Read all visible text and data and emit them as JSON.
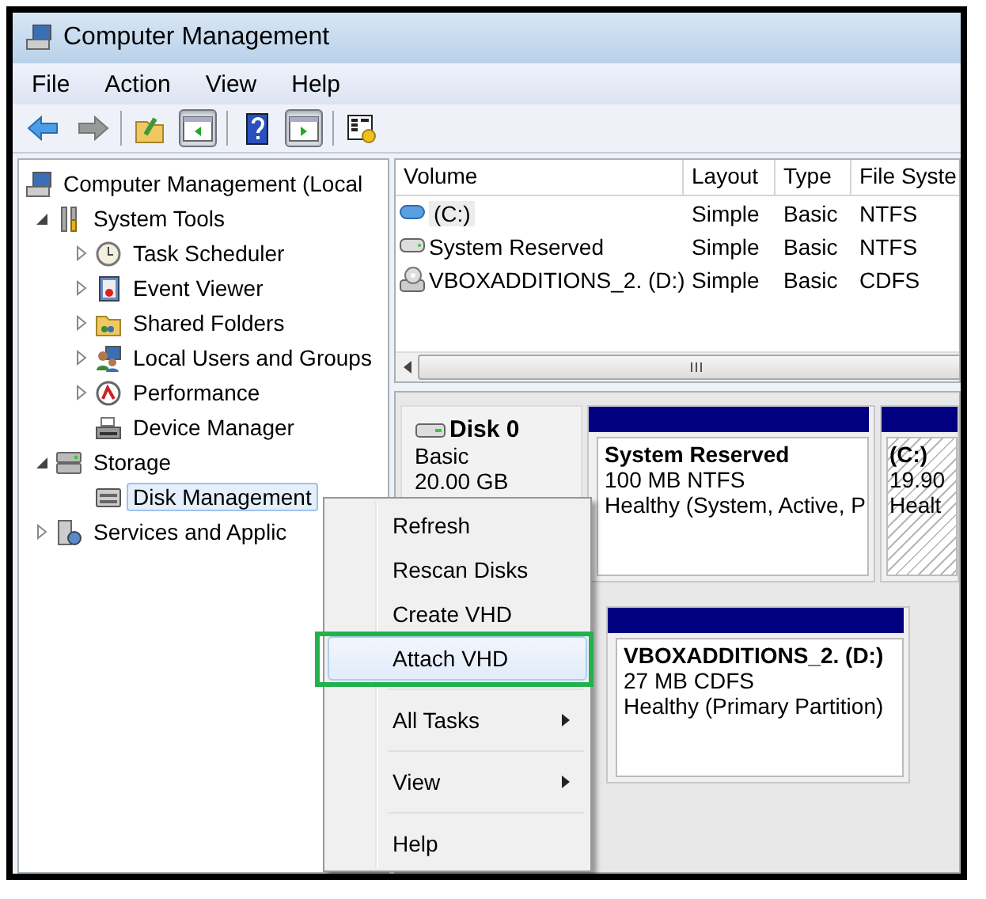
{
  "window": {
    "title": "Computer Management"
  },
  "menu_bar": [
    "File",
    "Action",
    "View",
    "Help"
  ],
  "toolbar": [
    {
      "kind": "back",
      "pressed": false
    },
    {
      "kind": "forward",
      "pressed": false
    },
    {
      "kind": "separator"
    },
    {
      "kind": "up",
      "pressed": false
    },
    {
      "kind": "pane-left",
      "pressed": true
    },
    {
      "kind": "separator"
    },
    {
      "kind": "help",
      "pressed": false
    },
    {
      "kind": "pane-right",
      "pressed": true
    },
    {
      "kind": "separator"
    },
    {
      "kind": "properties",
      "pressed": false
    }
  ],
  "tree": [
    {
      "label": "Computer Management (Local",
      "selected": false,
      "children": [
        {
          "label": "System Tools",
          "expanded": true,
          "selected": false,
          "children": [
            {
              "label": "Task Scheduler",
              "expanded": false,
              "selected": false
            },
            {
              "label": "Event Viewer",
              "expanded": false,
              "selected": false
            },
            {
              "label": "Shared Folders",
              "expanded": false,
              "selected": false
            },
            {
              "label": "Local Users and Groups",
              "expanded": false,
              "selected": false
            },
            {
              "label": "Performance",
              "expanded": false,
              "selected": false
            },
            {
              "label": "Device Manager",
              "selected": false
            }
          ]
        },
        {
          "label": "Storage",
          "expanded": true,
          "selected": false,
          "children": [
            {
              "label": "Disk Management",
              "selected": true
            }
          ]
        },
        {
          "label": "Services and Applic",
          "expanded": false,
          "selected": false
        }
      ]
    }
  ],
  "volume_table": {
    "columns": [
      "Volume",
      "Layout",
      "Type",
      "File Syste"
    ],
    "rows": [
      {
        "selected": true,
        "cells": [
          "(C:)",
          "Simple",
          "Basic",
          "NTFS"
        ]
      },
      {
        "selected": false,
        "cells": [
          "System Reserved",
          "Simple",
          "Basic",
          "NTFS"
        ]
      },
      {
        "selected": false,
        "cells": [
          "VBOXADDITIONS_2. (D:)",
          "Simple",
          "Basic",
          "CDFS"
        ]
      }
    ]
  },
  "disks": [
    {
      "name": "Disk 0",
      "lines": [
        "Basic",
        "20.00 GB"
      ],
      "partitions": [
        {
          "name": "System Reserved",
          "lines": [
            "100 MB NTFS",
            "Healthy (System, Active, P"
          ],
          "hatched": false
        },
        {
          "name": "(C:)",
          "lines": [
            "19.90",
            "Healt"
          ],
          "hatched": true
        }
      ]
    },
    {
      "partitions": [
        {
          "name": "VBOXADDITIONS_2.  (D:)",
          "lines": [
            "27 MB CDFS",
            "Healthy (Primary Partition)"
          ],
          "hatched": false
        }
      ]
    }
  ],
  "context_menu": [
    {
      "kind": "item",
      "label": "Refresh",
      "submenu": false,
      "highlighted": false
    },
    {
      "kind": "item",
      "label": "Rescan Disks",
      "submenu": false,
      "highlighted": false
    },
    {
      "kind": "item",
      "label": "Create VHD",
      "submenu": false,
      "highlighted": false
    },
    {
      "kind": "item",
      "label": "Attach VHD",
      "submenu": false,
      "highlighted": true
    },
    {
      "kind": "separator"
    },
    {
      "kind": "item",
      "label": "All Tasks",
      "submenu": true,
      "highlighted": false
    },
    {
      "kind": "separator"
    },
    {
      "kind": "item",
      "label": "View",
      "submenu": true,
      "highlighted": false
    },
    {
      "kind": "separator"
    },
    {
      "kind": "item",
      "label": "Help",
      "submenu": false,
      "highlighted": false
    }
  ]
}
